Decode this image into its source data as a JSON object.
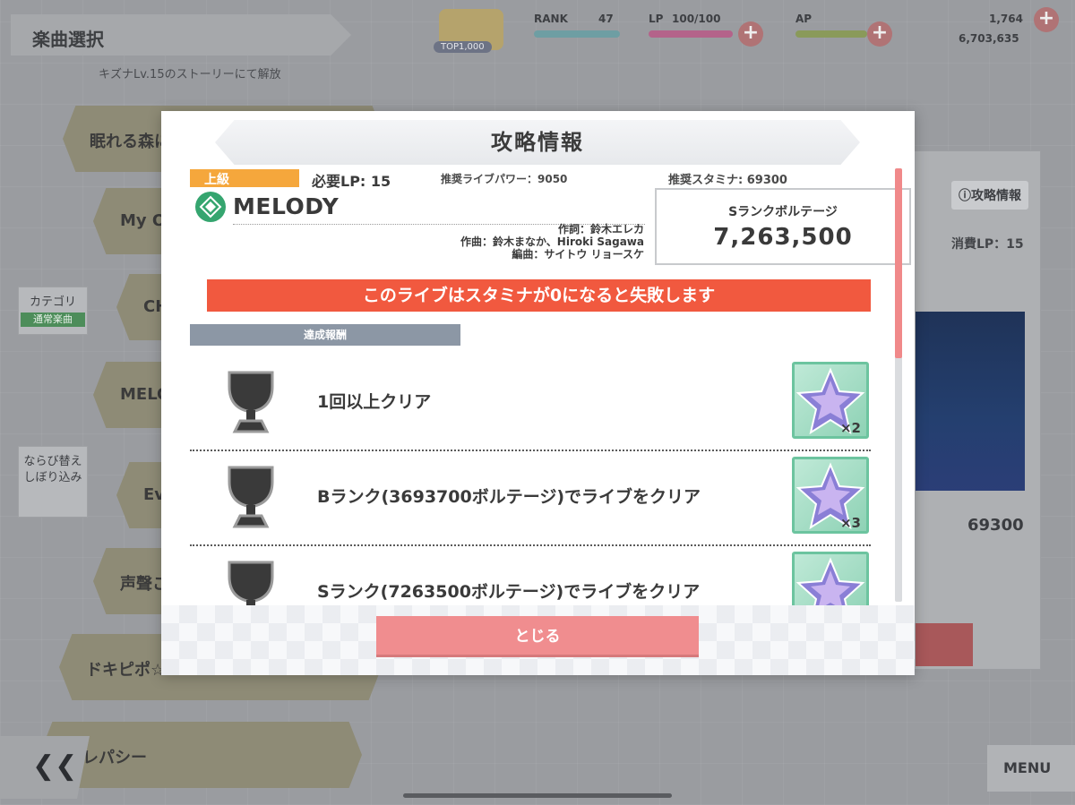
{
  "background": {
    "header_title": "楽曲選択",
    "unlock_note": "キズナLv.15のストーリーにて解放",
    "song_rows": [
      {
        "label": "眠れる森に"
      },
      {
        "label": "My Ow"
      },
      {
        "label": "CH"
      },
      {
        "label": "MELO"
      },
      {
        "label": "Eve"
      },
      {
        "label": "声聲こ"
      },
      {
        "label": "ドキピポ☆エ"
      },
      {
        "label": "テレパシー"
      }
    ],
    "side_category": "カテゴリ",
    "side_category_tag": "通常楽曲",
    "side_sort": "ならび替え\nしぼり込み",
    "back_glyph": "❮❮",
    "menu_label": "MENU",
    "right_info_label": "ⓘ攻略情報",
    "right_lp": "消費LP：15",
    "right_stamina": "69300",
    "topbar": {
      "rank_label": "RANK",
      "rank_value": "47",
      "lp_label": "LP",
      "lp_value": "100/100",
      "ap_label": "AP",
      "gems": "1,764",
      "gold": "6,703,635",
      "badge": "TOP1,000"
    }
  },
  "modal": {
    "title": "攻略情報",
    "difficulty": "上級",
    "required_lp": "必要LP: 15",
    "recommended_power": "推奨ライブパワー：9050",
    "recommended_stamina": "推奨スタミナ: 69300",
    "song_title": "MELODY",
    "credits": {
      "lyrics": "作詞：鈴木エレカ",
      "composition": "作曲：鈴木まなか、Hiroki Sagawa",
      "arrangement": "編曲：サイトウ リョースケ"
    },
    "s_rank_voltage_label": "Sランクボルテージ",
    "s_rank_voltage_value": "7,263,500",
    "warning": "このライブはスタミナが0になると失敗します",
    "rewards_header": "達成報酬",
    "rewards": [
      {
        "text": "1回以上クリア",
        "count": "×2"
      },
      {
        "text": "Bランク(3693700ボルテージ)でライブをクリア",
        "count": "×3"
      },
      {
        "text": "Sランク(7263500ボルテージ)でライブをクリア",
        "count": ""
      }
    ],
    "close_label": "とじる"
  },
  "colors": {
    "difficulty": "#f5a73c",
    "warning": "#f1593f",
    "close_button": "#f08d8f",
    "reward_header": "#8c97a5",
    "song_icon": "#35a56f"
  }
}
